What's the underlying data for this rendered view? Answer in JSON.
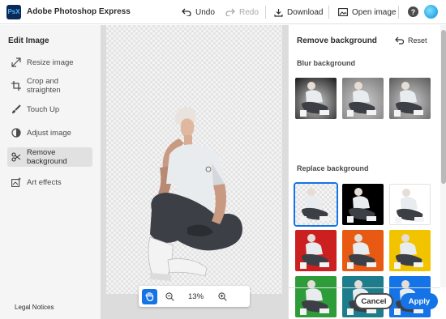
{
  "app": {
    "logo_text": "PsX",
    "title": "Adobe Photoshop Express"
  },
  "toolbar": {
    "undo": "Undo",
    "redo": "Redo",
    "download": "Download",
    "open_image": "Open image",
    "help_icon": "?"
  },
  "left_panel": {
    "title": "Edit Image",
    "items": [
      {
        "label": "Resize image",
        "icon": "resize-icon"
      },
      {
        "label": "Crop and straighten",
        "icon": "crop-icon"
      },
      {
        "label": "Touch Up",
        "icon": "brush-icon"
      },
      {
        "label": "Adjust image",
        "icon": "adjust-icon"
      },
      {
        "label": "Remove background",
        "icon": "scissors-icon",
        "active": true
      },
      {
        "label": "Art effects",
        "icon": "art-effects-icon"
      }
    ],
    "legal": "Legal Notices"
  },
  "canvas": {
    "zoom": "13%"
  },
  "right_panel": {
    "title": "Remove background",
    "reset": "Reset",
    "blur_section": "Blur background",
    "replace_section": "Replace background",
    "blur_thumbs": [
      "#1a1a1a",
      "#7a7a7a",
      "#5a5a5a"
    ],
    "replace_thumbs": [
      {
        "bg": "checker",
        "selected": true
      },
      {
        "bg": "#000000"
      },
      {
        "bg": "#ffffff"
      },
      {
        "bg": "#cc1f1f"
      },
      {
        "bg": "#e85a14"
      },
      {
        "bg": "#f2c400"
      },
      {
        "bg": "#2f9c3a"
      },
      {
        "bg": "#1d7d8c"
      },
      {
        "bg": "#1473e6"
      }
    ],
    "cancel": "Cancel",
    "apply": "Apply"
  },
  "colors": {
    "accent": "#1473e6",
    "panel_bg": "#f5f5f5"
  }
}
